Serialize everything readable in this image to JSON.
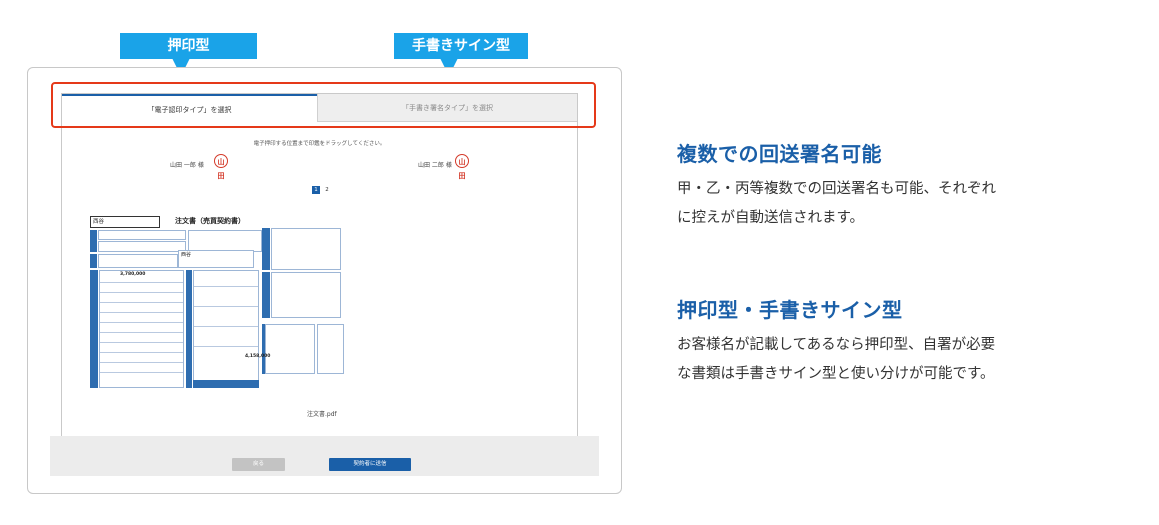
{
  "callouts": {
    "stamp_type": "押印型",
    "handwritten_type": "手書きサイン型"
  },
  "tabs": [
    {
      "label": "「電子認印タイプ」を選択",
      "active": true
    },
    {
      "label": "「手書き署名タイプ」を選択",
      "active": false
    }
  ],
  "document": {
    "instruction": "電子押印する位置まで印鑑をドラッグしてください。",
    "signers": [
      {
        "name": "山田 一郎 様",
        "seal": "山田"
      },
      {
        "name": "山田 二郎 様",
        "seal": "山田"
      }
    ],
    "pages": [
      "1",
      "2"
    ],
    "current_page": "1",
    "preview": {
      "title": "注文書（売買契約書）",
      "company": "西谷",
      "name": "西谷",
      "amount_1": "3,780,000",
      "amount_2": "4,158,000"
    },
    "filename": "注文書.pdf"
  },
  "footer": {
    "back_label": "戻る",
    "send_label": "契約者に送信"
  },
  "features": [
    {
      "title": "複数での回送署名可能",
      "lines": [
        "甲・乙・丙等複数での回送署名も可能、それぞれ",
        "に控えが自動送信されます。"
      ]
    },
    {
      "title": "押印型・手書きサイン型",
      "lines": [
        "お客様名が記載してあるなら押印型、自署が必要",
        "な書類は手書きサイン型と使い分けが可能です。"
      ]
    }
  ],
  "colors": {
    "accent": "#1aa3e8",
    "brand": "#1a5fa8",
    "highlight": "#e53919",
    "seal": "#d43a2a"
  }
}
